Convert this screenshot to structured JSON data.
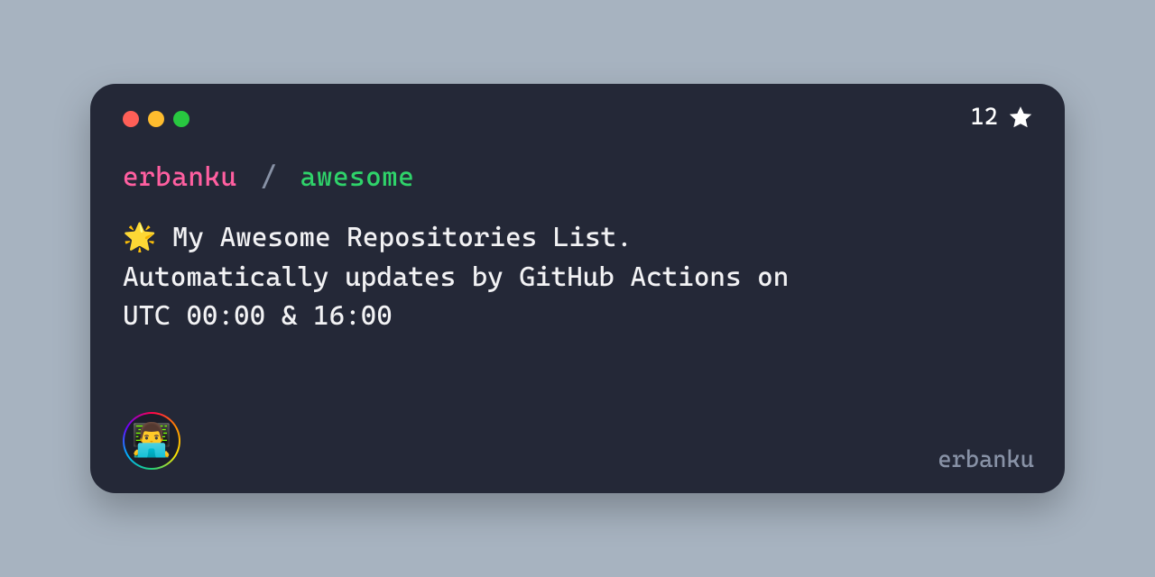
{
  "stars": {
    "count": "12"
  },
  "repo": {
    "owner": "erbanku",
    "separator": "/",
    "name": "awesome"
  },
  "description": "🌟 My Awesome Repositories List.\nAutomatically updates by GitHub Actions on\nUTC 00:00 & 16:00",
  "avatar": {
    "emoji": "👨‍💻"
  },
  "handle": "erbanku",
  "colors": {
    "background_page": "#a7b3c0",
    "card_bg": "#242837",
    "owner": "#ff5fa0",
    "repo": "#2fd36a",
    "muted": "#8892a6"
  }
}
